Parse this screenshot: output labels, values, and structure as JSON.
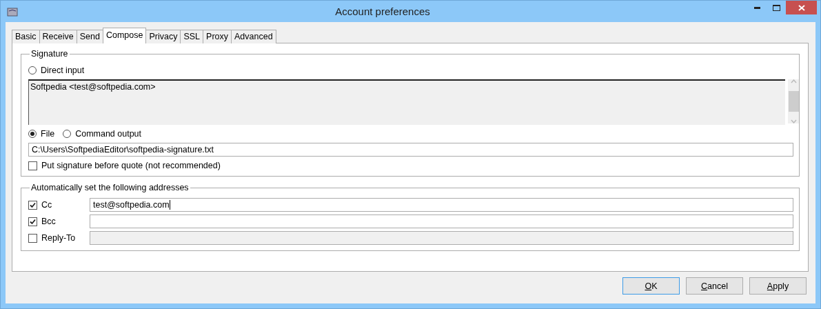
{
  "window": {
    "title": "Account preferences"
  },
  "tabs": [
    {
      "label": "Basic",
      "selected": false
    },
    {
      "label": "Receive",
      "selected": false
    },
    {
      "label": "Send",
      "selected": false
    },
    {
      "label": "Compose",
      "selected": true
    },
    {
      "label": "Privacy",
      "selected": false
    },
    {
      "label": "SSL",
      "selected": false
    },
    {
      "label": "Proxy",
      "selected": false
    },
    {
      "label": "Advanced",
      "selected": false
    }
  ],
  "signature": {
    "legend": "Signature",
    "direct_input": {
      "label": "Direct input",
      "selected": false
    },
    "text": "Softpedia <test@softpedia.com>",
    "sources": [
      {
        "label": "File",
        "selected": true
      },
      {
        "label": "Command output",
        "selected": false
      }
    ],
    "path": "C:\\Users\\SoftpediaEditor\\softpedia-signature.txt",
    "before_quote": {
      "label": "Put signature before quote (not recommended)",
      "checked": false
    }
  },
  "addresses": {
    "legend": "Automatically set the following addresses",
    "rows": [
      {
        "label": "Cc",
        "checked": true,
        "value": "test@softpedia.com"
      },
      {
        "label": "Bcc",
        "checked": true
      },
      {
        "label": "Reply-To",
        "checked": false
      }
    ]
  },
  "buttons": [
    {
      "label": "OK",
      "default": true
    },
    {
      "label": "Cancel",
      "default": false
    },
    {
      "label": "Apply",
      "default": false
    }
  ]
}
